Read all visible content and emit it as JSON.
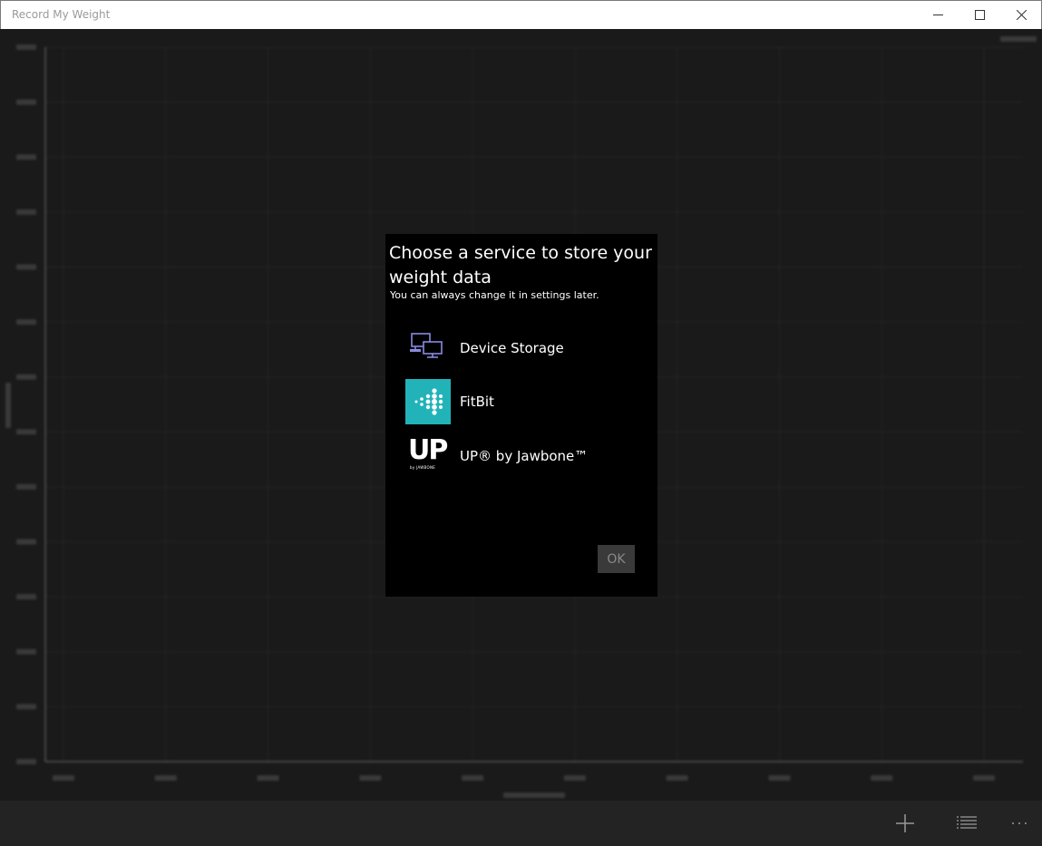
{
  "window": {
    "title": "Record My Weight"
  },
  "dialog": {
    "title": "Choose a service to store your weight data",
    "subtitle": "You can always change it in settings later.",
    "services": [
      {
        "label": "Device Storage",
        "icon": "device-storage-icon"
      },
      {
        "label": "FitBit",
        "icon": "fitbit-icon",
        "icon_bg": "#22b3b9"
      },
      {
        "label": "UP® by Jawbone™",
        "icon": "jawbone-up-icon"
      }
    ],
    "ok_label": "OK"
  },
  "appbar": {
    "buttons": [
      "add-icon",
      "list-icon",
      "more-icon"
    ]
  },
  "colors": {
    "titlebar_bg": "#ffffff",
    "chart_bg": "#1a1a1a",
    "dialog_bg": "#000000",
    "appbar_bg": "#232323",
    "fitbit_teal": "#22b3b9"
  }
}
